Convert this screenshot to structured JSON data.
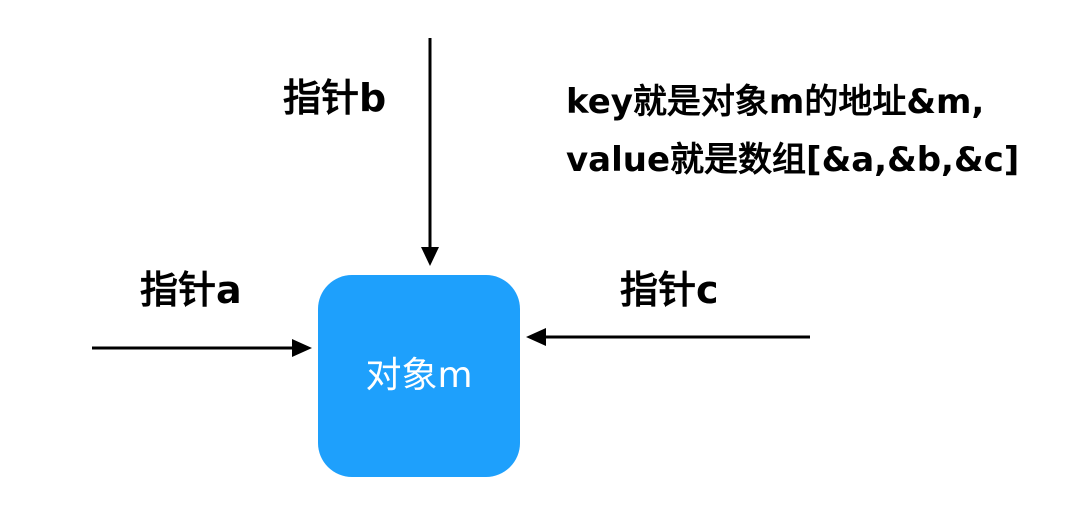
{
  "colors": {
    "object_fill": "#1ea0fc",
    "arrow": "#000000",
    "text": "#000000",
    "object_text": "#ffffff"
  },
  "pointers": {
    "a": "指针a",
    "b": "指针b",
    "c": "指针c"
  },
  "object": {
    "label": "对象m"
  },
  "note": {
    "line1": "key就是对象m的地址&m,",
    "line2": "value就是数组[&a,&b,&c]"
  }
}
